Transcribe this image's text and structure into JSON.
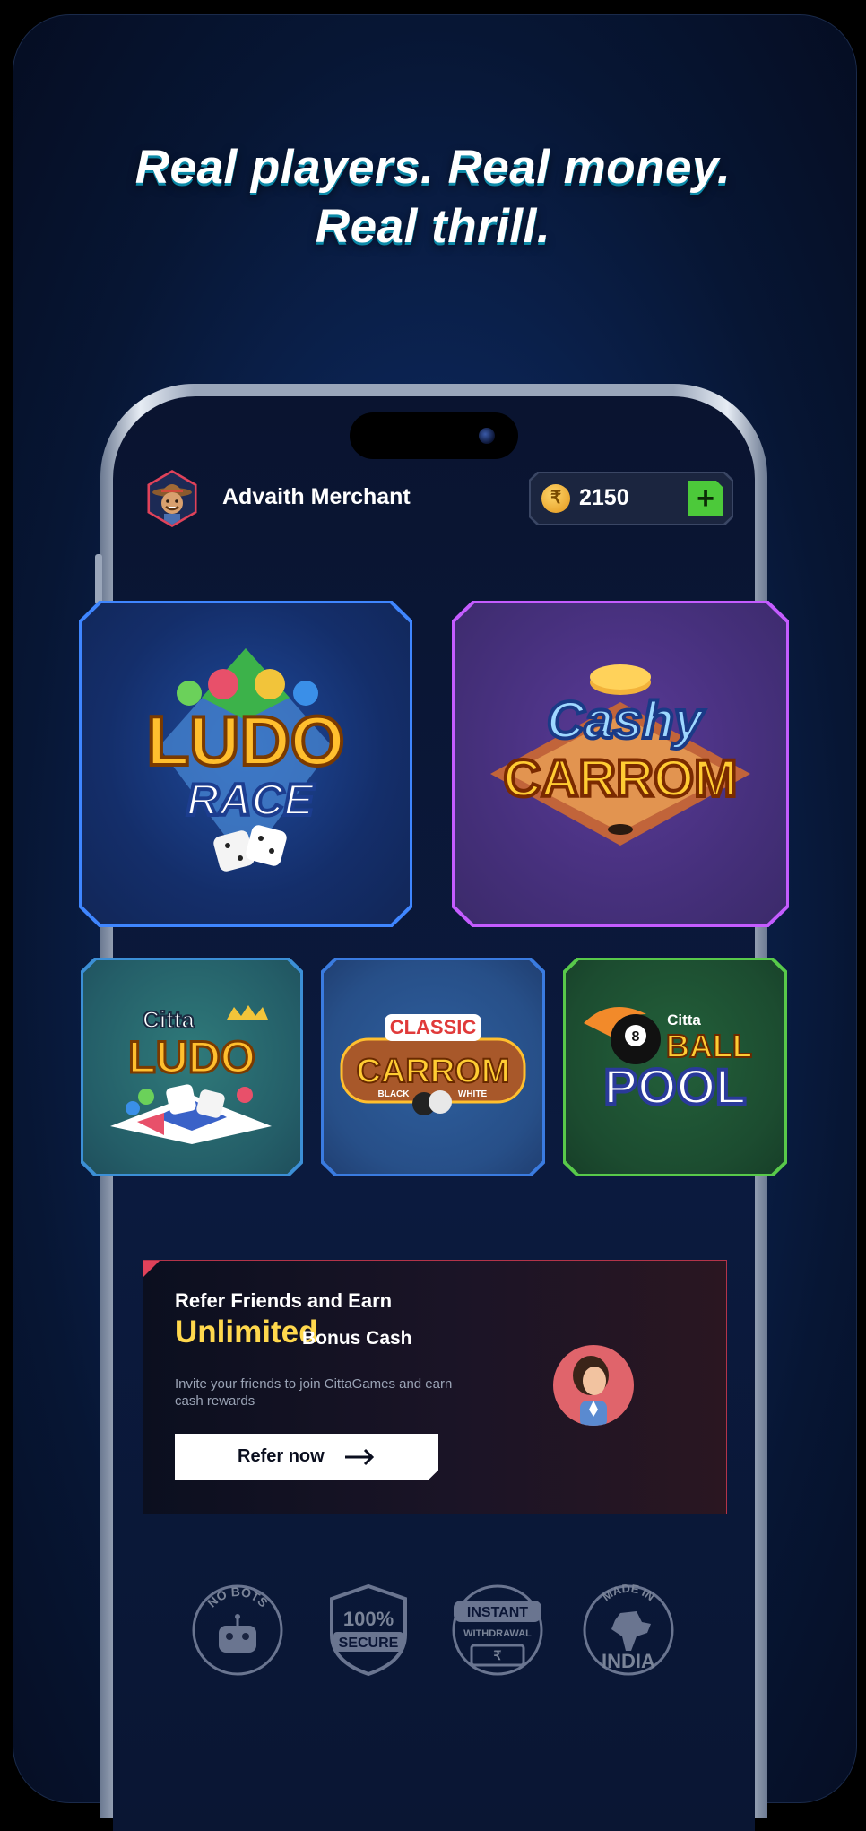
{
  "headline": {
    "line1": "Real players. Real money.",
    "line2": "Real thrill."
  },
  "profile": {
    "name": "Advaith Merchant",
    "balance": "2150",
    "currency_symbol": "₹",
    "add_label": "+"
  },
  "games": [
    {
      "title_top": "LUDO",
      "title_bottom": "RACE"
    },
    {
      "title_top": "Cashy",
      "title_bottom": "CARROM"
    },
    {
      "title_top": "Citta",
      "title_bottom": "LUDO"
    },
    {
      "title_top": "CLASSIC",
      "title_bottom": "CARROM",
      "sub_left": "BLACK",
      "sub_right": "WHITE"
    },
    {
      "title_top": "Citta",
      "title_mid": "BALL",
      "title_bottom": "POOL",
      "ball_number": "8"
    }
  ],
  "refer": {
    "line1": "Refer Friends and Earn",
    "highlight": "Unlimited",
    "line2_rest": "Bonus Cash",
    "description": "Invite your friends to join CittaGames and earn cash rewards",
    "button_label": "Refer now"
  },
  "badges": [
    {
      "text": "NO BOTS",
      "icon": "robot-icon"
    },
    {
      "text_top": "100%",
      "text_bottom": "SECURE",
      "icon": "shield-icon"
    },
    {
      "text_top": "INSTANT",
      "text_bottom": "WITHDRAWAL",
      "amount_symbol": "₹",
      "icon": "cash-icon"
    },
    {
      "text_top": "MADE IN",
      "text_bottom": "INDIA",
      "icon": "india-map-icon"
    }
  ],
  "colors": {
    "accent_gold": "#ffd84d",
    "add_green": "#4cc93a",
    "refer_border": "#b3344a"
  }
}
